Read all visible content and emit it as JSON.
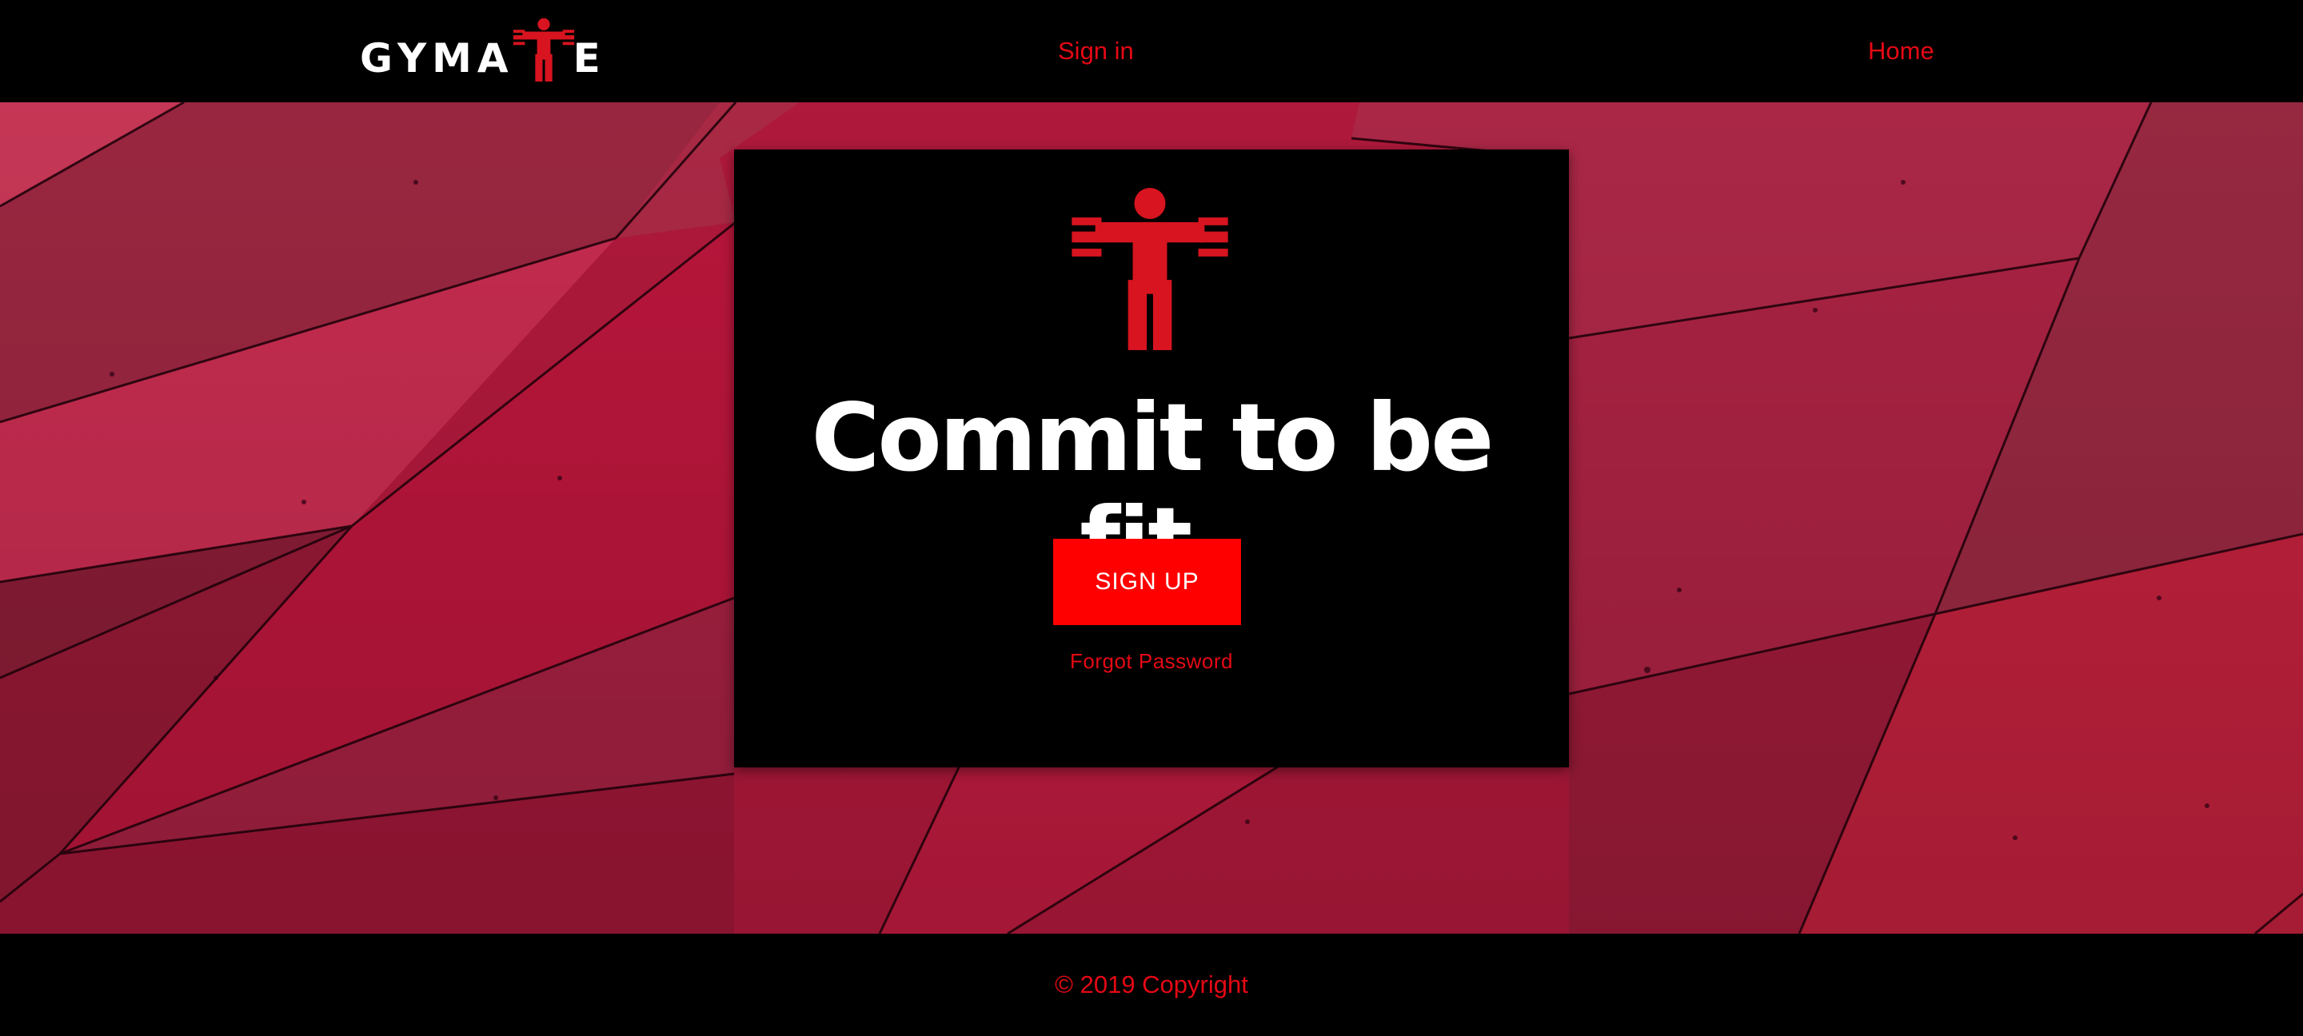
{
  "header": {
    "logo_text_left": "GYMA",
    "logo_text_right": "E",
    "nav": {
      "signin_label": "Sign in",
      "home_label": "Home"
    }
  },
  "hero": {
    "headline": "Commit to be fit.",
    "signup_label": "SIGN UP",
    "forgot_label": "Forgot Password"
  },
  "footer": {
    "copyright": "© 2019 Copyright"
  },
  "colors": {
    "brand_red": "#e50914",
    "button_red": "#ff0000",
    "figure_red": "#d7141f",
    "background": "#000000",
    "hero_base": "#b81a3e"
  },
  "icons": [
    "gym-figure-dumbbell-icon"
  ]
}
